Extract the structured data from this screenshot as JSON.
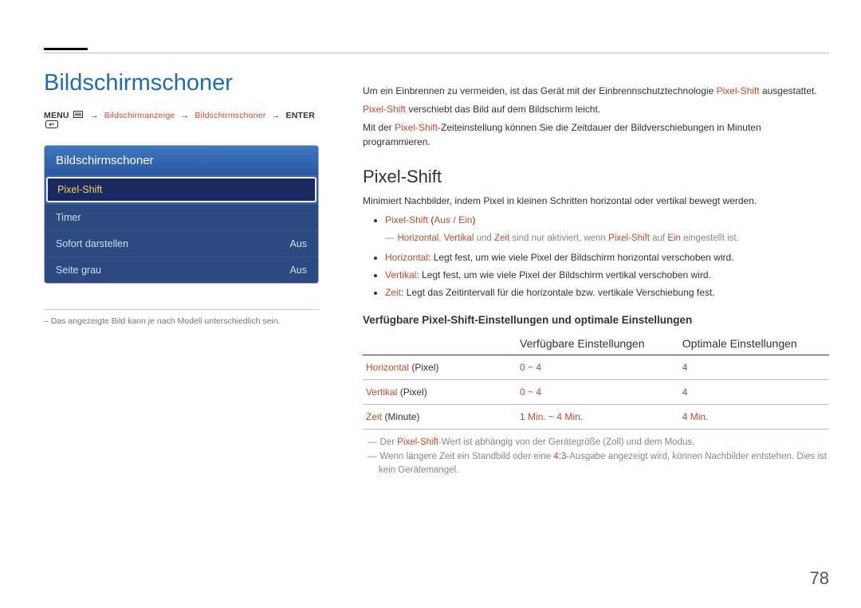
{
  "pageTitle": "Bildschirmschoner",
  "breadcrumb": {
    "menuLabel": "MENU",
    "path1": "Bildschirmanzeige",
    "path2": "Bildschirmschoner",
    "enterLabel": "ENTER"
  },
  "osd": {
    "title": "Bildschirmschoner",
    "items": [
      {
        "label": "Pixel-Shift",
        "value": "",
        "selected": true
      },
      {
        "label": "Timer",
        "value": ""
      },
      {
        "label": "Sofort darstellen",
        "value": "Aus"
      },
      {
        "label": "Seite grau",
        "value": "Aus"
      }
    ]
  },
  "osdCaption": "Das angezeigte Bild kann je nach Modell unterschiedlich sein.",
  "intro": {
    "p1a": "Um ein Einbrennen zu vermeiden, ist das Gerät mit der Einbrennschutztechnologie ",
    "p1term": "Pixel-Shift",
    "p1b": " ausgestattet.",
    "p2term": "Pixel-Shift",
    "p2b": " verschiebt das Bild auf dem Bildschirm leicht.",
    "p3a": "Mit der ",
    "p3term": "Pixel-Shift",
    "p3b": "-Zeiteinstellung können Sie die Zeitdauer der Bildverschiebungen in Minuten programmieren."
  },
  "section": {
    "heading": "Pixel-Shift",
    "desc": "Minimiert Nachbilder, indem Pixel in kleinen Schritten horizontal oder vertikal bewegt werden.",
    "option": {
      "term": "Pixel-Shift",
      "values": "Aus / Ein",
      "open": " (",
      "close": ")"
    },
    "note": {
      "p1": "Horizontal",
      "c1": ", ",
      "p2": "Vertikal",
      "c2": " und ",
      "p3": "Zeit",
      "c3": " sind nur aktiviert, wenn ",
      "p4": "Pixel-Shift",
      "c4": " auf ",
      "p5": "Ein",
      "c5": " eingestellt ist."
    },
    "bullets": {
      "b1term": "Horizontal",
      "b1text": ": Legt fest, um wie viele Pixel der Bildschirm horizontal verschoben wird.",
      "b2term": "Vertikal",
      "b2text": ": Legt fest, um wie viele Pixel der Bildschirm vertikal verschoben wird.",
      "b3term": "Zeit",
      "b3text": ": Legt das Zeitintervall für die horizontale bzw. vertikale Verschiebung fest."
    }
  },
  "table": {
    "heading": "Verfügbare Pixel-Shift-Einstellungen und optimale Einstellungen",
    "col0": "",
    "col1": "Verfügbare Einstellungen",
    "col2": "Optimale Einstellungen",
    "rows": [
      {
        "labelTerm": "Horizontal",
        "labelUnit": " (Pixel)",
        "avail": "0 ~ 4",
        "opt": "4"
      },
      {
        "labelTerm": "Vertikal",
        "labelUnit": " (Pixel)",
        "avail": "0 ~ 4",
        "opt": "4"
      },
      {
        "labelTerm": "Zeit",
        "labelUnit": " (Minute)",
        "avail": "1 Min. ~ 4 Min.",
        "opt": "4 Min."
      }
    ]
  },
  "footnotes": {
    "f1a": "Der ",
    "f1term": "Pixel-Shift",
    "f1b": "-Wert ist abhängig von der Gerätegröße (Zoll) und dem Modus.",
    "f2a": "Wenn längere Zeit ein Standbild oder eine ",
    "f2term": "4:3",
    "f2b": "-Ausgabe angezeigt wird, können Nachbilder entstehen. Dies ist kein Gerätemangel."
  },
  "pageNum": "78"
}
